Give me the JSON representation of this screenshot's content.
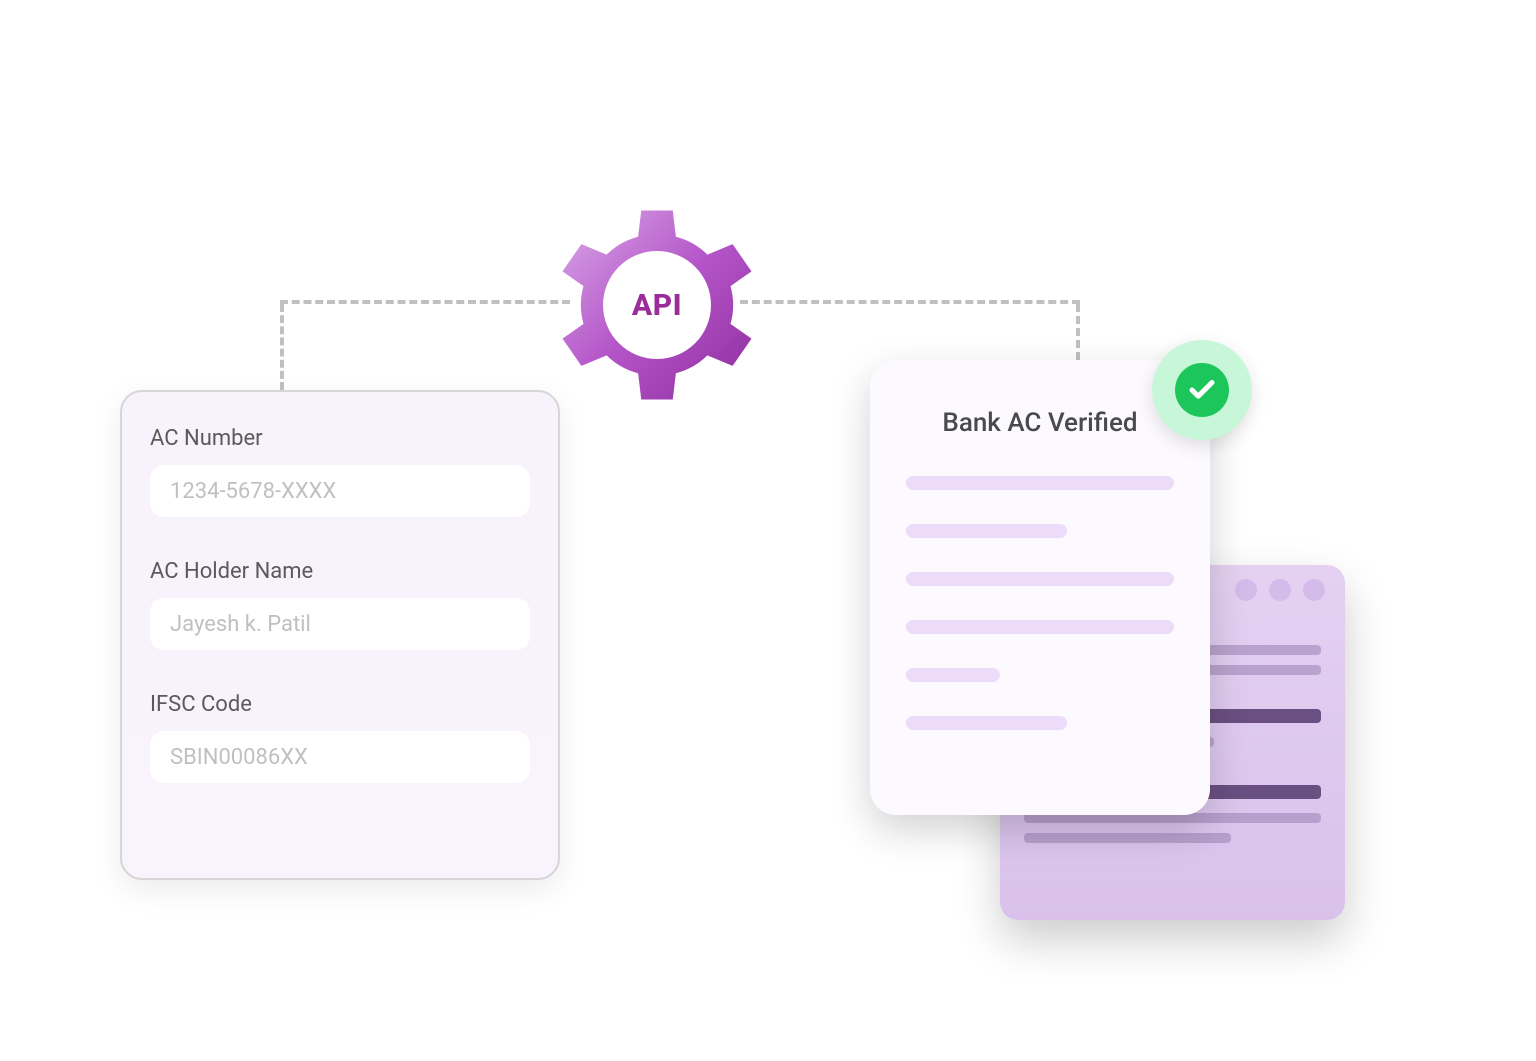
{
  "form": {
    "fields": [
      {
        "label": "AC Number",
        "placeholder": "1234-5678-XXXX"
      },
      {
        "label": "AC Holder Name",
        "placeholder": "Jayesh  k. Patil"
      },
      {
        "label": "IFSC Code",
        "placeholder": "SBIN00086XX"
      }
    ]
  },
  "api": {
    "label": "API"
  },
  "verified": {
    "title": "Bank AC Verified"
  }
}
